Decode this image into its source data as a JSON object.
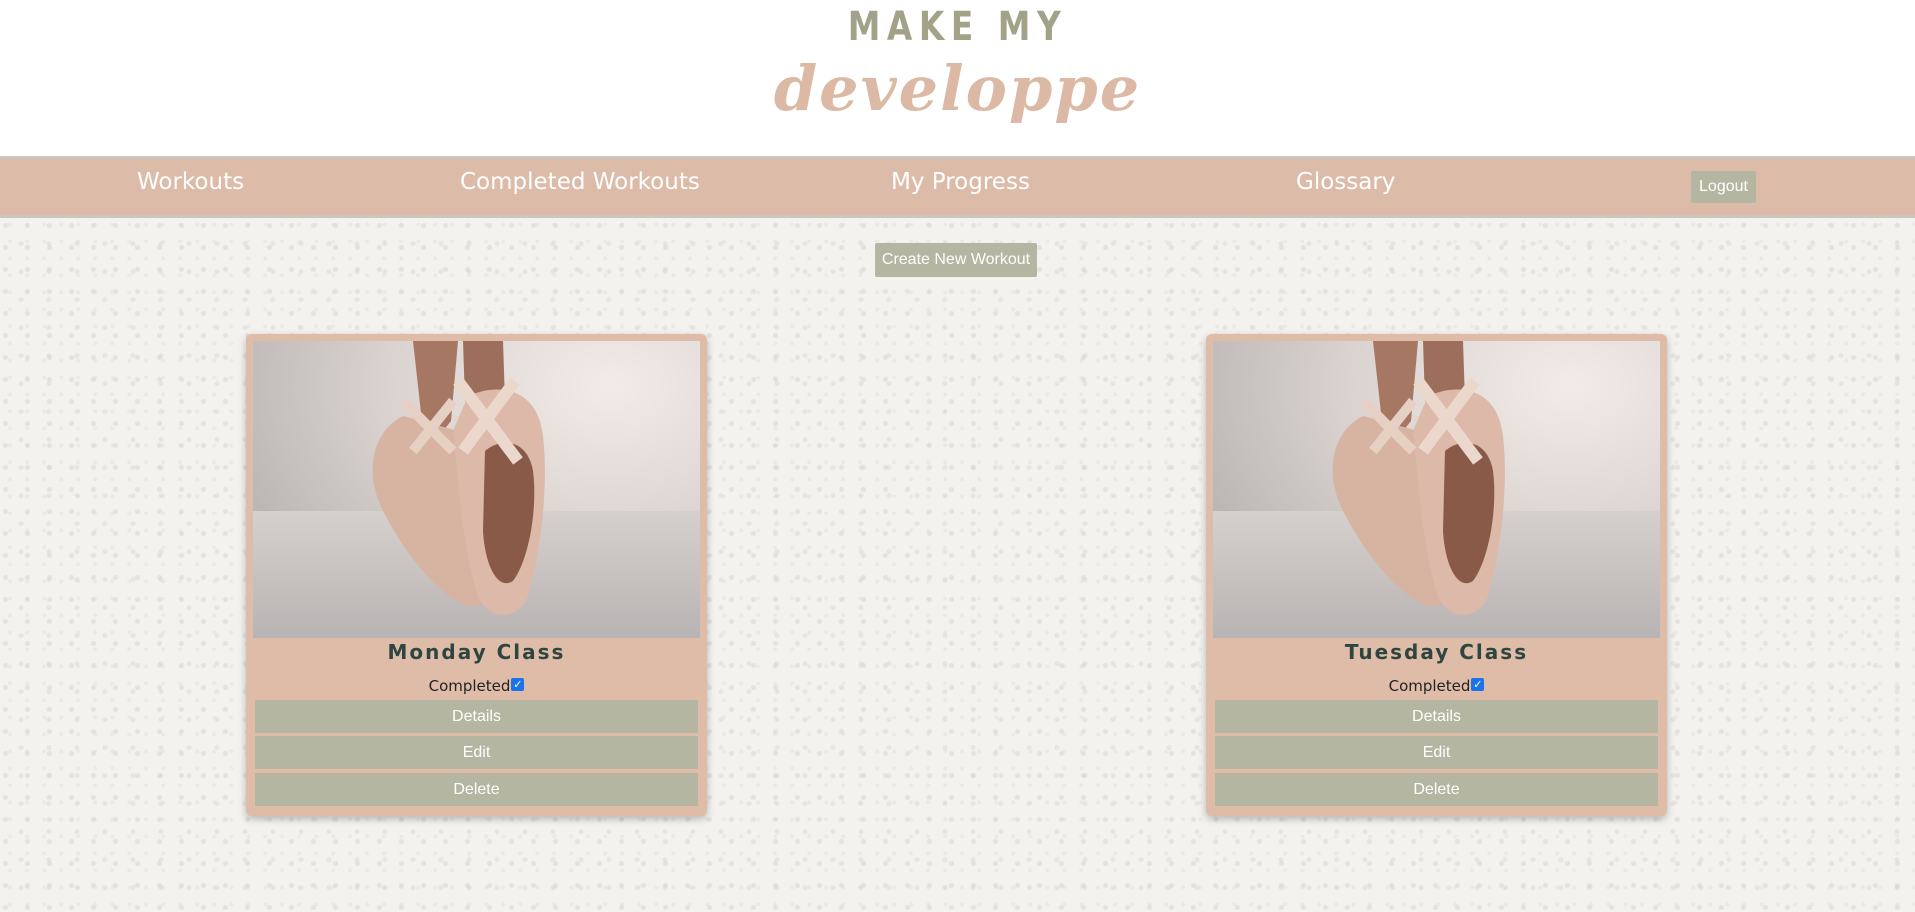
{
  "header": {
    "logo_top": "MAKE MY",
    "logo_bottom": "developpe"
  },
  "nav": {
    "items": [
      {
        "label": "Workouts"
      },
      {
        "label": "Completed Workouts"
      },
      {
        "label": "My Progress"
      },
      {
        "label": "Glossary"
      }
    ],
    "logout_label": "Logout"
  },
  "actions": {
    "create_label": "Create New Workout"
  },
  "workouts": [
    {
      "title": "Monday Class",
      "completed_label": "Completed",
      "completed": true,
      "details_label": "Details",
      "edit_label": "Edit",
      "delete_label": "Delete",
      "image": "ballet-pointe-shoes"
    },
    {
      "title": "Tuesday Class",
      "completed_label": "Completed",
      "completed": true,
      "details_label": "Details",
      "edit_label": "Edit",
      "delete_label": "Delete",
      "image": "ballet-pointe-shoes"
    }
  ],
  "colors": {
    "brand_sage": "#a3a289",
    "brand_blush": "#dcb9a4",
    "navbar": "#dcbca8",
    "button": "#b5b6a1",
    "title_text": "#2e4540",
    "checkbox": "#1a73e8"
  }
}
